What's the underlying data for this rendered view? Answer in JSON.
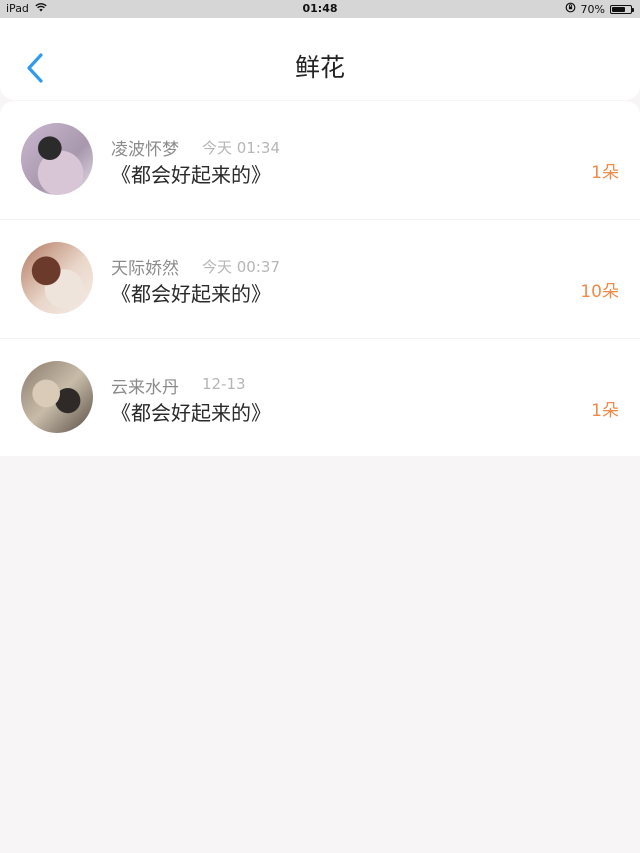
{
  "status_bar": {
    "device": "iPad",
    "time": "01:48",
    "battery": "70%",
    "battery_level": 0.7,
    "wifi_icon": "wifi-icon",
    "lock_icon": "orientation-lock-icon"
  },
  "nav": {
    "title": "鲜花",
    "back_icon": "chevron-left-icon",
    "accent_color": "#2e9bf0"
  },
  "colors": {
    "count": "#ef8a4a",
    "name": "#8b8b8b",
    "time": "#b6b6b6"
  },
  "items": [
    {
      "name": "凌波怀梦",
      "time": "今天 01:34",
      "title": "《都会好起来的》",
      "count": "1朵"
    },
    {
      "name": "天际娇然",
      "time": "今天 00:37",
      "title": "《都会好起来的》",
      "count": "10朵"
    },
    {
      "name": "云来水丹",
      "time": "12-13",
      "title": "《都会好起来的》",
      "count": "1朵"
    }
  ]
}
